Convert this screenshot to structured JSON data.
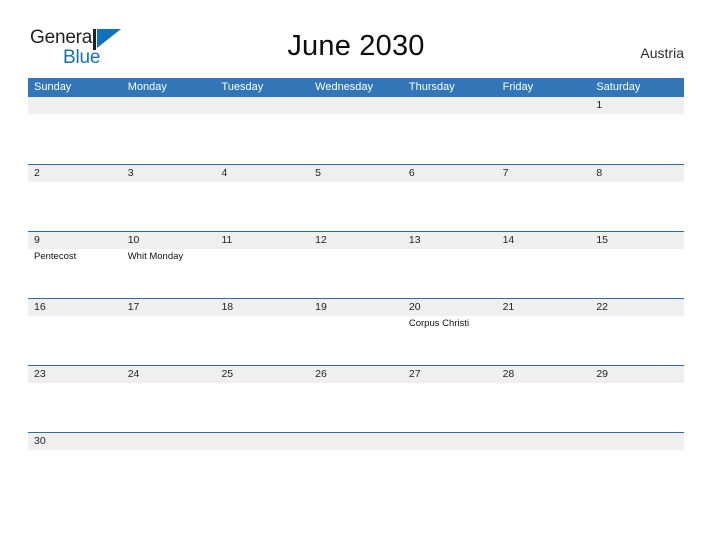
{
  "brand": {
    "name_part_1": "General",
    "name_part_2": "Blue",
    "accent_color": "#1172ba",
    "flag_icon": "flag-triangle-icon"
  },
  "header": {
    "title": "June 2030",
    "country": "Austria"
  },
  "colors": {
    "header_blue": "#3276b8",
    "row_line_blue": "#2e6da4",
    "date_band_gray": "#efefef",
    "text_dark": "#232323"
  },
  "calendar": {
    "month": "June",
    "year": "2030",
    "weekdays": [
      "Sunday",
      "Monday",
      "Tuesday",
      "Wednesday",
      "Thursday",
      "Friday",
      "Saturday"
    ],
    "weeks": [
      [
        {
          "date": "",
          "event": ""
        },
        {
          "date": "",
          "event": ""
        },
        {
          "date": "",
          "event": ""
        },
        {
          "date": "",
          "event": ""
        },
        {
          "date": "",
          "event": ""
        },
        {
          "date": "",
          "event": ""
        },
        {
          "date": "1",
          "event": ""
        }
      ],
      [
        {
          "date": "2",
          "event": ""
        },
        {
          "date": "3",
          "event": ""
        },
        {
          "date": "4",
          "event": ""
        },
        {
          "date": "5",
          "event": ""
        },
        {
          "date": "6",
          "event": ""
        },
        {
          "date": "7",
          "event": ""
        },
        {
          "date": "8",
          "event": ""
        }
      ],
      [
        {
          "date": "9",
          "event": "Pentecost"
        },
        {
          "date": "10",
          "event": "Whit Monday"
        },
        {
          "date": "11",
          "event": ""
        },
        {
          "date": "12",
          "event": ""
        },
        {
          "date": "13",
          "event": ""
        },
        {
          "date": "14",
          "event": ""
        },
        {
          "date": "15",
          "event": ""
        }
      ],
      [
        {
          "date": "16",
          "event": ""
        },
        {
          "date": "17",
          "event": ""
        },
        {
          "date": "18",
          "event": ""
        },
        {
          "date": "19",
          "event": ""
        },
        {
          "date": "20",
          "event": "Corpus Christi"
        },
        {
          "date": "21",
          "event": ""
        },
        {
          "date": "22",
          "event": ""
        }
      ],
      [
        {
          "date": "23",
          "event": ""
        },
        {
          "date": "24",
          "event": ""
        },
        {
          "date": "25",
          "event": ""
        },
        {
          "date": "26",
          "event": ""
        },
        {
          "date": "27",
          "event": ""
        },
        {
          "date": "28",
          "event": ""
        },
        {
          "date": "29",
          "event": ""
        }
      ],
      [
        {
          "date": "30",
          "event": ""
        },
        {
          "date": "",
          "event": ""
        },
        {
          "date": "",
          "event": ""
        },
        {
          "date": "",
          "event": ""
        },
        {
          "date": "",
          "event": ""
        },
        {
          "date": "",
          "event": ""
        },
        {
          "date": "",
          "event": ""
        }
      ]
    ]
  }
}
